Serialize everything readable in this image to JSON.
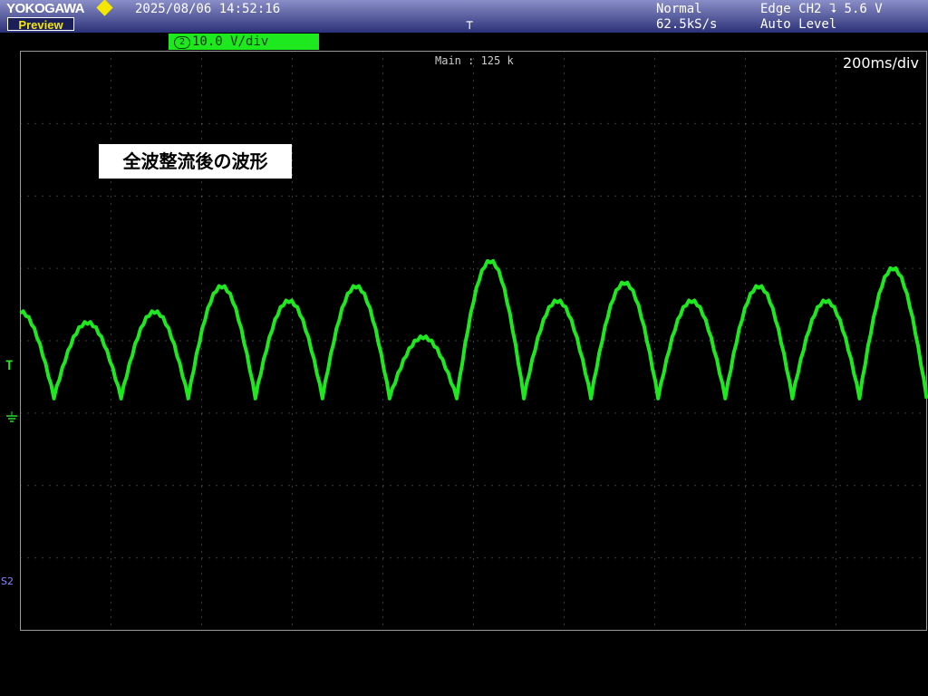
{
  "header": {
    "brand": "YOKOGAWA",
    "mode_badge": "Preview",
    "datetime": "2025/08/06 14:52:16",
    "acq_mode": "Normal",
    "sample_rate": "62.5kS/s",
    "trigger_info": "Edge CH2 ⮧ 5.6 V",
    "trigger_level_mode": "Auto Level",
    "trigger_icon": "trigger-position-icon"
  },
  "channel": {
    "number": "2",
    "scale": "10.0 V/div",
    "color": "#1ee81e",
    "coupling_icon": "dc-coupling-icon"
  },
  "screen": {
    "main_label": "Main : 125 k",
    "timebase": "200ms/div",
    "annotation": "全波整流後の波形",
    "side_label": "S2",
    "trigger_marker": "T"
  },
  "colors": {
    "trace": "#1ee81e",
    "background": "#000000",
    "grid": "#7a7a7a",
    "header_bar": "#3a4090"
  },
  "waveform": {
    "description_type": "full-wave rectified (arches)",
    "peaks_div": [
      0.15,
      0.0,
      0.15,
      0.5,
      0.3,
      0.5,
      -0.2,
      0.85,
      0.3,
      0.55,
      0.3,
      0.5,
      0.3,
      0.75
    ],
    "valley_div": 1.2
  }
}
